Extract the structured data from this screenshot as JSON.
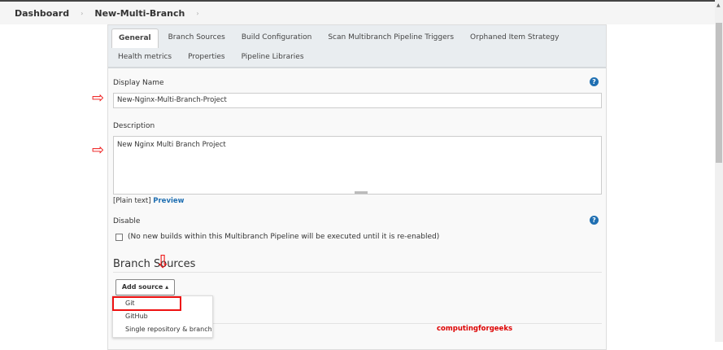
{
  "breadcrumb": [
    "Dashboard",
    "New-Multi-Branch"
  ],
  "tabs": [
    "General",
    "Branch Sources",
    "Build Configuration",
    "Scan Multibranch Pipeline Triggers",
    "Orphaned Item Strategy",
    "Health metrics",
    "Properties",
    "Pipeline Libraries"
  ],
  "form": {
    "display_name_label": "Display Name",
    "display_name_value": "New-Nginx-Multi-Branch-Project",
    "description_label": "Description",
    "description_value": "New Nginx Multi Branch Project",
    "plain_text": "[Plain text]",
    "preview": "Preview",
    "disable_label": "Disable",
    "disable_checkbox_label": "(No new builds within this Multibranch Pipeline will be executed until it is re-enabled)",
    "help": "?"
  },
  "branch_sources": {
    "heading": "Branch Sources",
    "add_source": "Add source ▴",
    "menu": [
      "Git",
      "GitHub",
      "Single repository & branch"
    ]
  },
  "watermark": "computingforgeeks"
}
